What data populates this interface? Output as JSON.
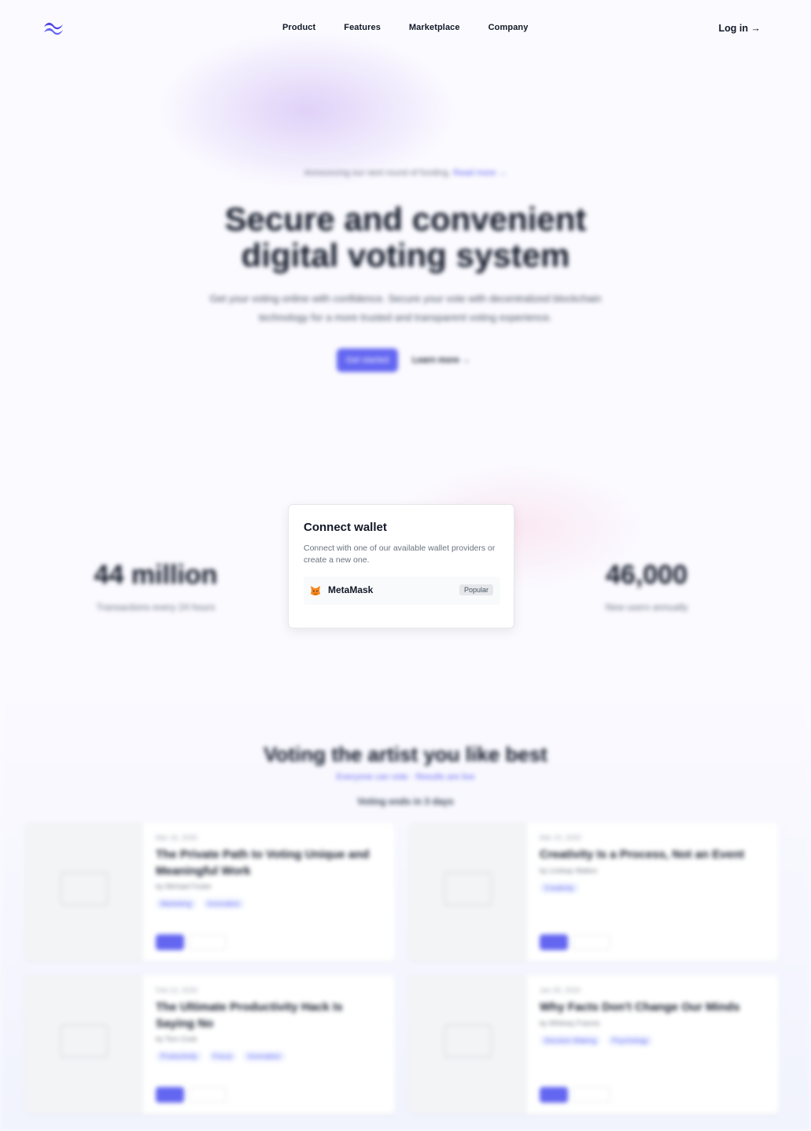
{
  "header": {
    "nav": [
      "Product",
      "Features",
      "Marketplace",
      "Company"
    ],
    "login_label": "Log in →"
  },
  "hero": {
    "announcement": "Announcing our next round of funding.",
    "announcement_link": "Read more →",
    "title_line1": "Secure and convenient",
    "title_line2": "digital voting system",
    "subtitle": "Get your voting online with confidence. Secure your vote with decentralized blockchain technology for a more trusted and transparent voting experience.",
    "cta_primary": "Get started",
    "cta_secondary": "Learn more →"
  },
  "stats": {
    "left_value": "44 million",
    "left_label": "Transactions every 24 hours",
    "right_value": "46,000",
    "right_label": "New users annually"
  },
  "modal": {
    "title": "Connect wallet",
    "description": "Connect with one of our available wallet providers or create a new one.",
    "wallet_name": "MetaMask",
    "wallet_badge": "Popular"
  },
  "section": {
    "title": "Voting the artist you like best",
    "links": "Everyone can vote · Results are live",
    "subtitle": "Voting ends in 3 days"
  },
  "cards": [
    {
      "meta": "Mar 16, 2020",
      "title": "The Private Path to Voting Unique and Meaningful Work",
      "author": "by Michael Foster",
      "tags": [
        "Marketing",
        "Innovation"
      ]
    },
    {
      "meta": "Mar 10, 2020",
      "title": "Creativity Is a Process, Not an Event",
      "author": "by Lindsay Walton",
      "tags": [
        "Creativity"
      ]
    },
    {
      "meta": "Feb 12, 2020",
      "title": "The Ultimate Productivity Hack Is Saying No",
      "author": "by Tom Cook",
      "tags": [
        "Productivity",
        "Focus",
        "Innovation"
      ]
    },
    {
      "meta": "Jan 30, 2020",
      "title": "Why Facts Don't Change Our Minds",
      "author": "by Whitney Francis",
      "tags": [
        "Decision Making",
        "Psychology"
      ]
    }
  ]
}
